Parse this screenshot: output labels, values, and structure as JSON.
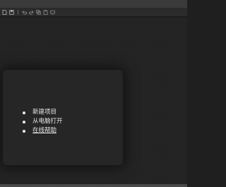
{
  "toolbar": {
    "icons": [
      "file-icon",
      "save-icon",
      "undo-icon",
      "redo-icon",
      "copy-icon",
      "paste-icon",
      "screen-icon"
    ]
  },
  "welcome": {
    "items": [
      {
        "label": "新建项目"
      },
      {
        "label": "从电脑打开"
      },
      {
        "label": "在线帮助"
      }
    ]
  },
  "colors": {
    "background": "#202020",
    "card": "#262626",
    "text": "#e6e6e6",
    "titlebar": "#3a3a3a",
    "toolbar": "#2b2b2b"
  }
}
